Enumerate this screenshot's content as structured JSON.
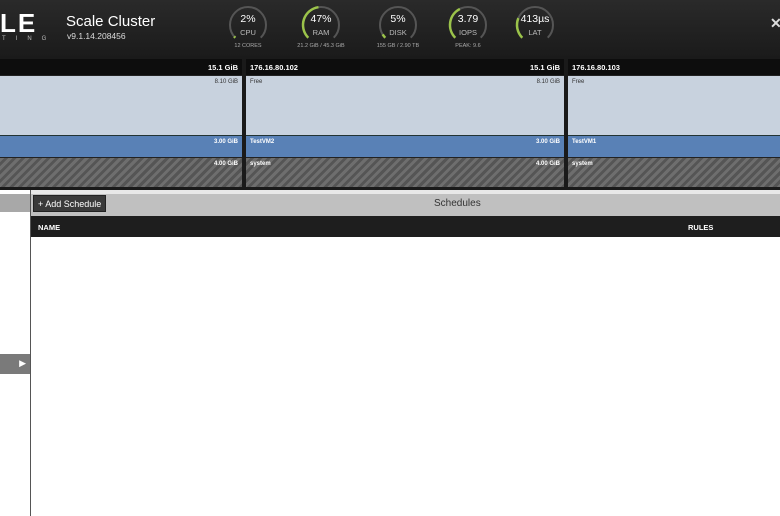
{
  "header": {
    "logo": "LE",
    "logo_sub": "TING",
    "cluster_title": "Scale Cluster",
    "cluster_version": "v9.1.14.208456",
    "close_glyph": "✕"
  },
  "gauges": [
    {
      "value": "2%",
      "label": "CPU",
      "sub": "12 CORES",
      "level": 0.02
    },
    {
      "value": "47%",
      "label": "RAM",
      "sub": "21.2 GiB / 45.3 GiB",
      "level": 0.47
    },
    {
      "value": "5%",
      "label": "DISK",
      "sub": "155 GB / 2.90 TB",
      "level": 0.05
    },
    {
      "value": "3.79",
      "label": "IOPS",
      "sub": "PEAK: 9.6",
      "level": 0.4
    },
    {
      "value": "413µs",
      "label": "LAT",
      "sub": "",
      "level": 0.25
    }
  ],
  "gauge_color": "#9bc34a",
  "nodes": [
    {
      "ip": "",
      "capacity": "15.1 GiB",
      "free_label": "",
      "free_size": "8.10 GiB",
      "vm_label": "",
      "vm_size": "3.00 GiB",
      "sys_label": "",
      "sys_size": "4.00 GiB"
    },
    {
      "ip": "176.16.80.102",
      "capacity": "15.1 GiB",
      "free_label": "Free",
      "free_size": "8.10 GiB",
      "vm_label": "TestVM2",
      "vm_size": "3.00 GiB",
      "sys_label": "system",
      "sys_size": "4.00 GiB"
    },
    {
      "ip": "176.16.80.103",
      "capacity": "",
      "free_label": "Free",
      "free_size": "",
      "vm_label": "TestVM1",
      "vm_size": "",
      "sys_label": "system",
      "sys_size": ""
    }
  ],
  "sidebar": {
    "collapse_glyph": "▶"
  },
  "schedules": {
    "add_button": "+ Add Schedule",
    "title": "Schedules",
    "columns": {
      "name": "NAME",
      "rules": "RULES"
    }
  }
}
